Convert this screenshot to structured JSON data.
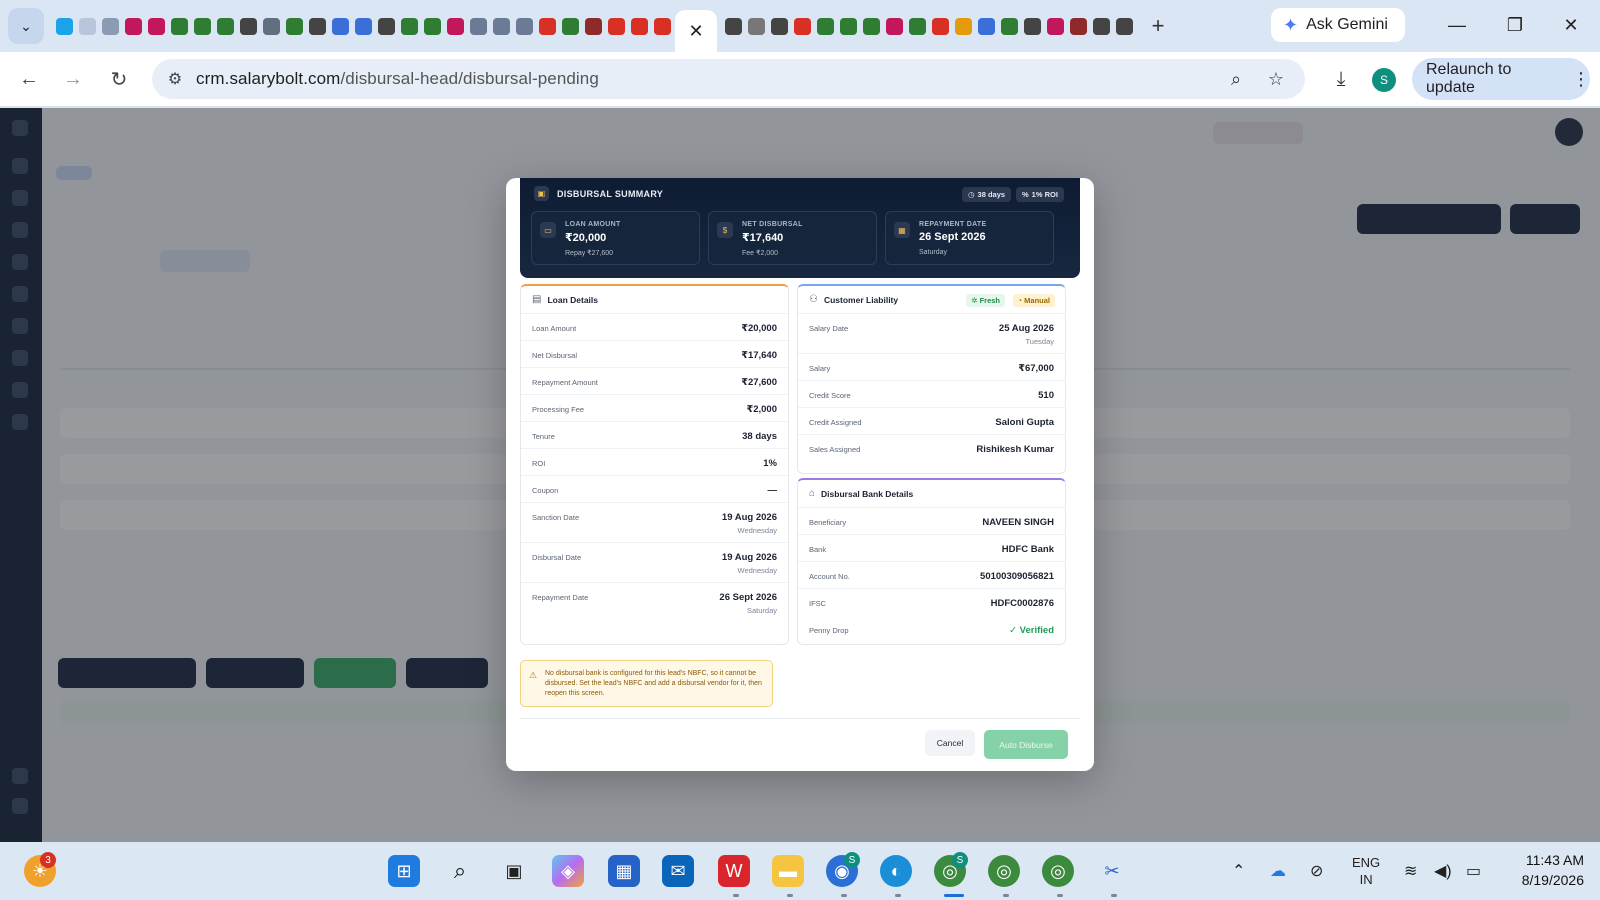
{
  "browser": {
    "active_tab_close": "✕",
    "new_tab": "+",
    "ask_gemini": "Ask Gemini",
    "url_host": "crm.salarybolt.com",
    "url_path": "/disbursal-head/disbursal-pending",
    "profile_initial": "S",
    "relaunch": "Relaunch to update",
    "favicon_colors": [
      "#1aa3e8",
      "#b8c6dc",
      "#8b9bb3",
      "#c2185b",
      "#c2185b",
      "#2e7d32",
      "#2e7d32",
      "#2e7d32",
      "#444444",
      "#607080",
      "#2e7d32",
      "#444444",
      "#3b6fd8",
      "#3b6fd8",
      "#444444",
      "#2e7d32",
      "#2e7d32",
      "#c2185b",
      "#6b7b96",
      "#6b7b96",
      "#6b7b96",
      "#d93025",
      "#2e7d32",
      "#8f2a2a",
      "#d93025",
      "#d93025",
      "#d93025"
    ],
    "favicon_colors_right": [
      "#444444",
      "#777777",
      "#444444",
      "#d93025",
      "#2e7d32",
      "#2e7d32",
      "#2e7d32",
      "#c2185b",
      "#2e7d32",
      "#d93025",
      "#e39b0b",
      "#3b6fd8",
      "#2e7d32",
      "#444444",
      "#c2185b",
      "#8f2a2a",
      "#444444",
      "#444444"
    ]
  },
  "modal": {
    "summary": {
      "title": "DISBURSAL SUMMARY",
      "chip_days": "38 days",
      "chip_roi": "1% ROI",
      "cards": [
        {
          "label": "LOAN AMOUNT",
          "value": "₹20,000",
          "sub": "Repay ₹27,600",
          "icon": "wallet-icon"
        },
        {
          "label": "NET DISBURSAL",
          "value": "₹17,640",
          "sub": "Fee ₹2,000",
          "icon": "coin-icon"
        },
        {
          "label": "REPAYMENT DATE",
          "value": "26 Sept 2026",
          "sub": "Saturday",
          "icon": "calendar-icon"
        }
      ]
    },
    "loan_details": {
      "title": "Loan Details",
      "accent": "#f0a04a",
      "rows": [
        {
          "key": "Loan Amount",
          "value": "₹20,000",
          "day": ""
        },
        {
          "key": "Net Disbursal",
          "value": "₹17,640",
          "day": ""
        },
        {
          "key": "Repayment Amount",
          "value": "₹27,600",
          "day": ""
        },
        {
          "key": "Processing Fee",
          "value": "₹2,000",
          "day": ""
        },
        {
          "key": "Tenure",
          "value": "38 days",
          "day": ""
        },
        {
          "key": "ROI",
          "value": "1%",
          "day": ""
        },
        {
          "key": "Coupon",
          "value": "—",
          "day": ""
        },
        {
          "key": "Sanction Date",
          "value": "19 Aug 2026",
          "day": "Wednesday"
        },
        {
          "key": "Disbursal Date",
          "value": "19 Aug 2026",
          "day": "Wednesday"
        },
        {
          "key": "Repayment Date",
          "value": "26 Sept 2026",
          "day": "Saturday"
        }
      ]
    },
    "customer_liability": {
      "title": "Customer Liability",
      "accent": "#7aa6e8",
      "tag_fresh": "Fresh",
      "tag_manual": "Manual",
      "rows": [
        {
          "key": "Salary Date",
          "value": "25 Aug 2026",
          "day": "Tuesday"
        },
        {
          "key": "Salary",
          "value": "₹67,000",
          "day": ""
        },
        {
          "key": "Credit Score",
          "value": "510",
          "day": ""
        },
        {
          "key": "Credit Assigned",
          "value": "Saloni Gupta",
          "day": ""
        },
        {
          "key": "Sales Assigned",
          "value": "Rishikesh Kumar",
          "day": ""
        }
      ]
    },
    "bank_details": {
      "title": "Disbursal Bank Details",
      "accent": "#9b7be0",
      "rows": [
        {
          "key": "Beneficiary",
          "value": "NAVEEN SINGH"
        },
        {
          "key": "Bank",
          "value": "HDFC Bank"
        },
        {
          "key": "Account No.",
          "value": "50100309056821"
        },
        {
          "key": "IFSC",
          "value": "HDFC0002876"
        }
      ],
      "penny_drop_label": "Penny Drop",
      "penny_drop_value": "Verified"
    },
    "warning": "No disbursal bank is configured for this lead's NBFC, so it cannot be disbursed. Set the lead's NBFC and add a disbursal vendor for it, then reopen this screen.",
    "cancel": "Cancel",
    "auto_disburse": "Auto Disburse"
  },
  "taskbar": {
    "weather_badge": "3",
    "chat_badge": "S",
    "chrome_badge": "S",
    "lang_top": "ENG",
    "lang_bottom": "IN",
    "time": "11:43 AM",
    "date": "8/19/2026"
  }
}
